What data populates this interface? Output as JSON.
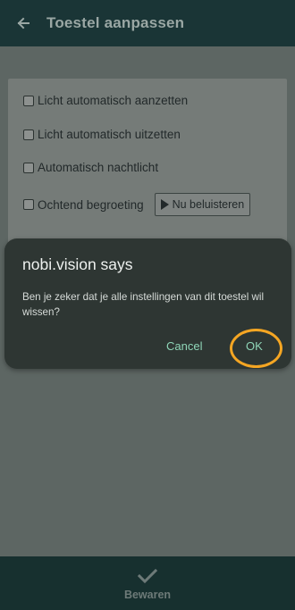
{
  "header": {
    "title": "Toestel aanpassen",
    "back_icon": "arrow-left-icon"
  },
  "settings": {
    "options": [
      {
        "label": "Licht automatisch aanzetten",
        "checked": false
      },
      {
        "label": "Licht automatisch uitzetten",
        "checked": false
      },
      {
        "label": "Automatisch nachtlicht",
        "checked": false
      },
      {
        "label": "Ochtend begroeting",
        "checked": false
      }
    ],
    "listen_button_label": "Nu beluisteren",
    "listen_icon": "play-icon"
  },
  "dialog": {
    "title": "nobi.vision says",
    "message": "Ben je zeker dat je alle instellingen van dit toestel wil wissen?",
    "cancel_label": "Cancel",
    "ok_label": "OK"
  },
  "footer": {
    "save_label": "Bewaren",
    "save_icon": "checkmark-icon"
  },
  "colors": {
    "app_bar": "#1a3536",
    "dialog_bg": "#2e3633",
    "button_text": "#8fd6b8",
    "highlight_ring": "#f5a623"
  }
}
